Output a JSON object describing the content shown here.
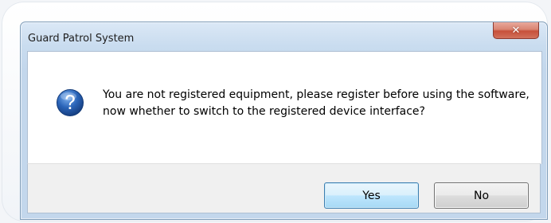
{
  "window": {
    "title": "Guard Patrol System",
    "close_symbol": "✕"
  },
  "message": {
    "icon": "question-icon",
    "text": "You are not registered equipment, please register before using the software, now whether to switch to the registered device interface?"
  },
  "buttons": {
    "yes_label": "Yes",
    "no_label": "No"
  },
  "colors": {
    "titlebar": "#c9dcef",
    "close_button": "#c7503a",
    "question_icon": "#2a64b8",
    "default_button_border": "#3c7fb1"
  }
}
